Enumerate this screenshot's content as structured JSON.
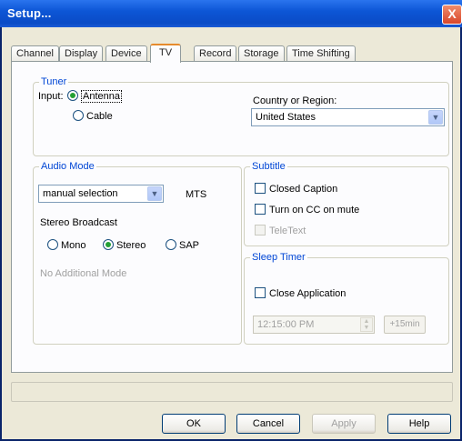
{
  "window": {
    "title": "Setup...",
    "close_label": "X"
  },
  "tabs": [
    {
      "label": "Channel"
    },
    {
      "label": "Display"
    },
    {
      "label": "Device"
    },
    {
      "label": "TV"
    },
    {
      "label": "Record"
    },
    {
      "label": "Storage"
    },
    {
      "label": "Time Shifting"
    }
  ],
  "active_tab": "TV",
  "tuner": {
    "group_label": "Tuner",
    "input_label": "Input:",
    "antenna_label": "Antenna",
    "cable_label": "Cable",
    "selected": "Antenna",
    "country_label": "Country or Region:",
    "country_value": "United States"
  },
  "audio": {
    "group_label": "Audio Mode",
    "mode_value": "manual selection",
    "mts_label": "MTS",
    "stereo_broadcast_label": "Stereo Broadcast",
    "mono_label": "Mono",
    "stereo_label": "Stereo",
    "sap_label": "SAP",
    "selected": "Stereo",
    "additional_label": "No Additional Mode"
  },
  "subtitle": {
    "group_label": "Subtitle",
    "closed_caption_label": "Closed Caption",
    "cc_on_mute_label": "Turn on CC on mute",
    "teletext_label": "TeleText"
  },
  "sleep_timer": {
    "group_label": "Sleep Timer",
    "close_app_label": "Close Application",
    "time_value": "12:15:00 PM",
    "add_label": "+15min"
  },
  "buttons": {
    "ok": "OK",
    "cancel": "Cancel",
    "apply": "Apply",
    "help": "Help"
  },
  "colors": {
    "titlebar": "#0a4bc6",
    "group_label": "#0046d5",
    "active_tab_accent": "#e68b2c",
    "radio_dot": "#24a035"
  }
}
